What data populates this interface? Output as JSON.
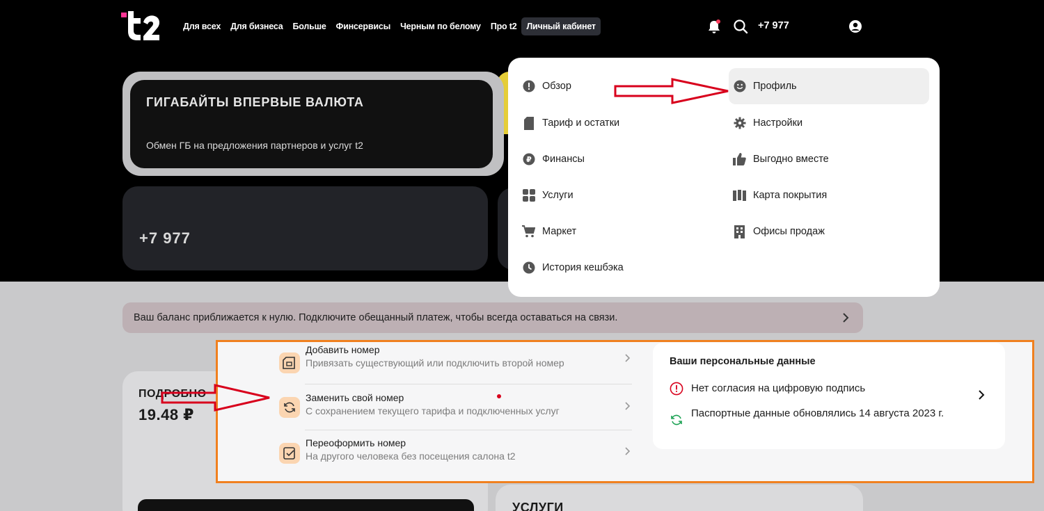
{
  "header": {
    "nav": [
      "Для всех",
      "Для бизнеса",
      "Больше",
      "Финсервисы",
      "Черным по белому",
      "Про t2",
      "Личный кабинет"
    ],
    "phone": "+7 977"
  },
  "promo": {
    "title": "ГИГАБАЙТЫ ВПЕРВЫЕ ВАЛЮТА",
    "subtitle": "Обмен ГБ на предложения партнеров и услуг t2"
  },
  "phone_card": {
    "number": "+7 977"
  },
  "menu": {
    "left": [
      {
        "label": "Обзор",
        "icon": "exclamation-circle-icon"
      },
      {
        "label": "Тариф и остатки",
        "icon": "sim-card-icon"
      },
      {
        "label": "Финансы",
        "icon": "ruble-coin-icon"
      },
      {
        "label": "Услуги",
        "icon": "grid-icon"
      },
      {
        "label": "Маркет",
        "icon": "cart-icon"
      },
      {
        "label": "История кешбэка",
        "icon": "clock-icon"
      }
    ],
    "right": [
      {
        "label": "Профиль",
        "icon": "smile-icon"
      },
      {
        "label": "Настройки",
        "icon": "gear-icon"
      },
      {
        "label": "Выгодно вместе",
        "icon": "thumbs-up-icon"
      },
      {
        "label": "Карта покрытия",
        "icon": "map-icon"
      },
      {
        "label": "Офисы продаж",
        "icon": "building-icon"
      }
    ]
  },
  "banner": {
    "text": "Ваш баланс приближается к нулю. Подключите обещанный платеж, чтобы всегда оставаться на связи."
  },
  "balance": {
    "title": "ПОДРОБНО",
    "amount": "19.48 ₽"
  },
  "services_card": {
    "title": "УСЛУГИ"
  },
  "number_actions": [
    {
      "title": "Добавить номер",
      "subtitle": "Привязать существующий или подключить второй номер",
      "icon": "add-sim-icon"
    },
    {
      "title": "Заменить свой номер",
      "subtitle": "С сохранением текущего тарифа и подключенных услуг",
      "icon": "refresh-icon"
    },
    {
      "title": "Переоформить номер",
      "subtitle": "На другого человека без посещения салона t2",
      "icon": "document-check-icon"
    }
  ],
  "personal_data": {
    "title": "Ваши персональные данные",
    "line1": "Нет согласия на цифровую подпись",
    "line2": "Паспортные данные обновлялись 14 августа 2023 г."
  },
  "colors": {
    "accent_orange": "#f0801f",
    "arrow_red": "#d8001c",
    "status_green": "#1aa152"
  }
}
